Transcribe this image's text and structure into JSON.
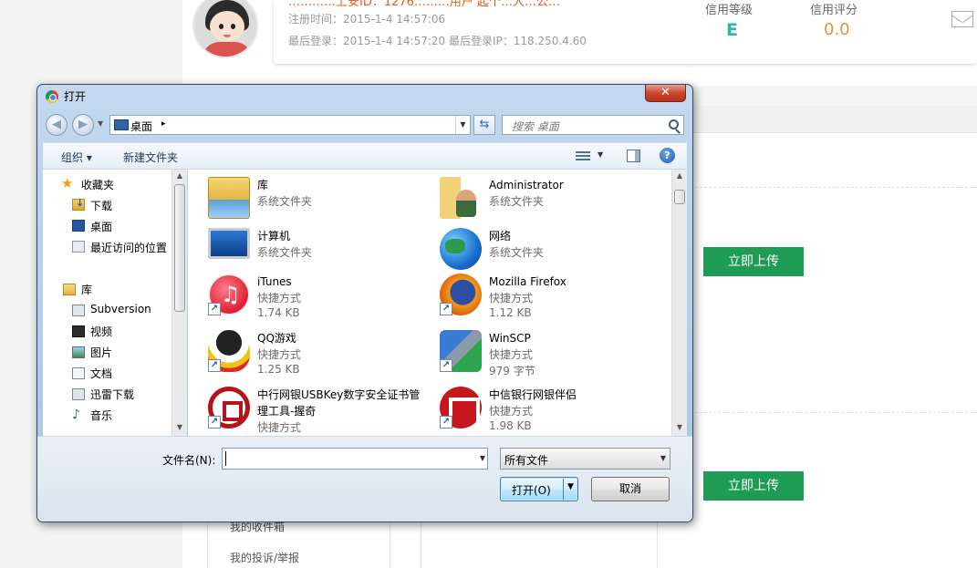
{
  "background_page": {
    "top_orange_text": "…………上安ID：1276………用户 起个…人…公…",
    "register_time": "注册时间：2015-1-4 14:57:06",
    "last_login": "最后登录：2015-1-4 14:57:20 最后登录IP：118.250.4.60",
    "credit_level_label": "信用等级",
    "credit_level_value": "E",
    "credit_score_label": "信用评分",
    "credit_score_value": "0.0",
    "upload_button_label": "立即上传",
    "left_nav": [
      "我的收件箱",
      "我的投诉/举报"
    ],
    "colors": {
      "accent_green": "#1e9c55",
      "level_teal": "#2fb2b5",
      "score_orange": "#e39434"
    }
  },
  "dialog": {
    "title": "打开",
    "close_glyph": "✕",
    "address": {
      "location": "桌面",
      "separator": "▸"
    },
    "search_placeholder": "搜索 桌面",
    "toolbar": {
      "organize": "组织 ▾",
      "new_folder": "新建文件夹",
      "help": "?"
    },
    "nav_pane": {
      "favorites_header": "收藏夹",
      "favorites": [
        "下载",
        "桌面",
        "最近访问的位置"
      ],
      "libraries_header": "库",
      "libraries": [
        "Subversion",
        "视频",
        "图片",
        "文档",
        "迅雷下载",
        "音乐"
      ]
    },
    "files": [
      {
        "name": "库",
        "type": "系统文件夹",
        "size": "",
        "icon": "library-icon"
      },
      {
        "name": "Administrator",
        "type": "系统文件夹",
        "size": "",
        "icon": "user-folder-icon"
      },
      {
        "name": "计算机",
        "type": "系统文件夹",
        "size": "",
        "icon": "computer-icon"
      },
      {
        "name": "网络",
        "type": "系统文件夹",
        "size": "",
        "icon": "network-icon"
      },
      {
        "name": "iTunes",
        "type": "快捷方式",
        "size": "1.74 KB",
        "icon": "itunes-icon"
      },
      {
        "name": "Mozilla Firefox",
        "type": "快捷方式",
        "size": "1.12 KB",
        "icon": "firefox-icon"
      },
      {
        "name": "QQ游戏",
        "type": "快捷方式",
        "size": "1.25 KB",
        "icon": "qq-game-icon"
      },
      {
        "name": "WinSCP",
        "type": "快捷方式",
        "size": "979 字节",
        "icon": "winscp-icon"
      },
      {
        "name": "中行网银USBKey数字安全证书管",
        "name2": "理工具-握奇",
        "type": "快捷方式",
        "size": "",
        "icon": "boc-icon"
      },
      {
        "name": "中信银行网银伴侣",
        "type": "快捷方式",
        "size": "1.98 KB",
        "icon": "citic-icon"
      }
    ],
    "filename_label": "文件名(N):",
    "filename_value": "",
    "filter_value": "所有文件",
    "open_button": "打开(O)",
    "cancel_button": "取消"
  }
}
